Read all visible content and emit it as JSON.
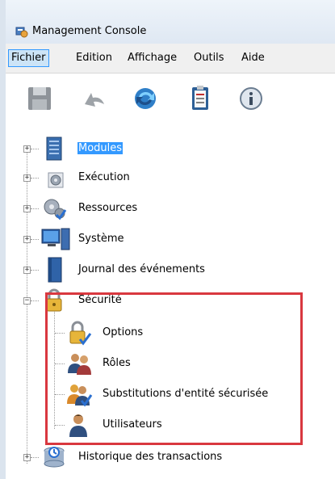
{
  "window": {
    "title": "Management Console"
  },
  "menu": [
    "Fichier",
    "Edition",
    "Affichage",
    "Outils",
    "Aide"
  ],
  "toolbar": {
    "buttons": [
      {
        "icon": "save-icon"
      },
      {
        "icon": "undo-icon"
      },
      {
        "icon": "refresh-icon"
      },
      {
        "icon": "clipboard-icon"
      },
      {
        "icon": "info-icon"
      }
    ]
  },
  "tree": {
    "nodes": [
      {
        "label": "Modules",
        "icon": "server-icon",
        "expanded": false,
        "selected": true
      },
      {
        "label": "Exécution",
        "icon": "gear-icon",
        "expanded": false
      },
      {
        "label": "Ressources",
        "icon": "gears-check-icon",
        "expanded": false
      },
      {
        "label": "Système",
        "icon": "computer-icon",
        "expanded": false
      },
      {
        "label": "Journal des événements",
        "icon": "book-icon",
        "expanded": false
      },
      {
        "label": "Sécurité",
        "icon": "padlock-icon",
        "expanded": true,
        "children": [
          {
            "label": "Options",
            "icon": "padlock-check-icon"
          },
          {
            "label": "Rôles",
            "icon": "users-icon"
          },
          {
            "label": "Substitutions d'entité sécurisée",
            "icon": "users-check-icon"
          },
          {
            "label": "Utilisateurs",
            "icon": "user-icon"
          }
        ]
      },
      {
        "label": "Historique des transactions",
        "icon": "database-clock-icon",
        "expanded": false
      }
    ]
  },
  "colors": {
    "highlight_box": "#d9383f",
    "selection": "#3399ff",
    "menu_active": "#cce4f7"
  }
}
